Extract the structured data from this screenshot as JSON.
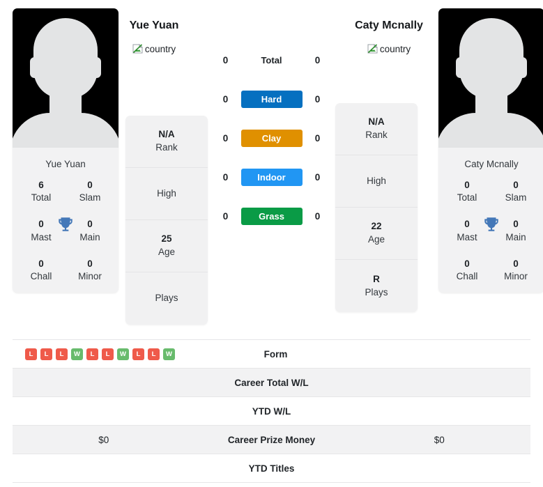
{
  "players": {
    "left": {
      "name": "Yue Yuan",
      "card_name": "Yue Yuan",
      "country_alt": "country",
      "titles": [
        {
          "value": "6",
          "label": "Total"
        },
        {
          "value": "0",
          "label": "Slam"
        },
        {
          "value": "0",
          "label": "Mast"
        },
        {
          "value": "0",
          "label": "Main"
        },
        {
          "value": "0",
          "label": "Chall"
        },
        {
          "value": "0",
          "label": "Minor"
        }
      ],
      "info": [
        {
          "value": "N/A",
          "label": "Rank"
        },
        {
          "value": "",
          "label": "High"
        },
        {
          "value": "25",
          "label": "Age"
        },
        {
          "value": "",
          "label": "Plays"
        }
      ]
    },
    "right": {
      "name": "Caty Mcnally",
      "card_name": "Caty Mcnally",
      "country_alt": "country",
      "titles": [
        {
          "value": "0",
          "label": "Total"
        },
        {
          "value": "0",
          "label": "Slam"
        },
        {
          "value": "0",
          "label": "Mast"
        },
        {
          "value": "0",
          "label": "Main"
        },
        {
          "value": "0",
          "label": "Chall"
        },
        {
          "value": "0",
          "label": "Minor"
        }
      ],
      "info": [
        {
          "value": "N/A",
          "label": "Rank"
        },
        {
          "value": "",
          "label": "High"
        },
        {
          "value": "22",
          "label": "Age"
        },
        {
          "value": "R",
          "label": "Plays"
        }
      ]
    }
  },
  "surface_comparison": [
    {
      "label": "Total",
      "left": "0",
      "right": "0",
      "badge": false,
      "color": ""
    },
    {
      "label": "Hard",
      "left": "0",
      "right": "0",
      "badge": true,
      "color": "#0670c0"
    },
    {
      "label": "Clay",
      "left": "0",
      "right": "0",
      "badge": true,
      "color": "#e09000"
    },
    {
      "label": "Indoor",
      "left": "0",
      "right": "0",
      "badge": true,
      "color": "#2196f3"
    },
    {
      "label": "Grass",
      "left": "0",
      "right": "0",
      "badge": true,
      "color": "#0a9b46"
    }
  ],
  "stats_table": [
    {
      "label": "Form",
      "left_form": [
        "L",
        "L",
        "L",
        "W",
        "L",
        "L",
        "W",
        "L",
        "L",
        "W"
      ],
      "right_form": [],
      "left": "",
      "right": "",
      "shaded": false
    },
    {
      "label": "Career Total W/L",
      "left": "",
      "right": "",
      "shaded": true
    },
    {
      "label": "YTD W/L",
      "left": "",
      "right": "",
      "shaded": false
    },
    {
      "label": "Career Prize Money",
      "left": "$0",
      "right": "$0",
      "shaded": true
    },
    {
      "label": "YTD Titles",
      "left": "",
      "right": "",
      "shaded": false
    }
  ],
  "colors": {
    "win": "#68bb6c",
    "loss": "#ef5a4a",
    "trophy": "#4478b8"
  }
}
